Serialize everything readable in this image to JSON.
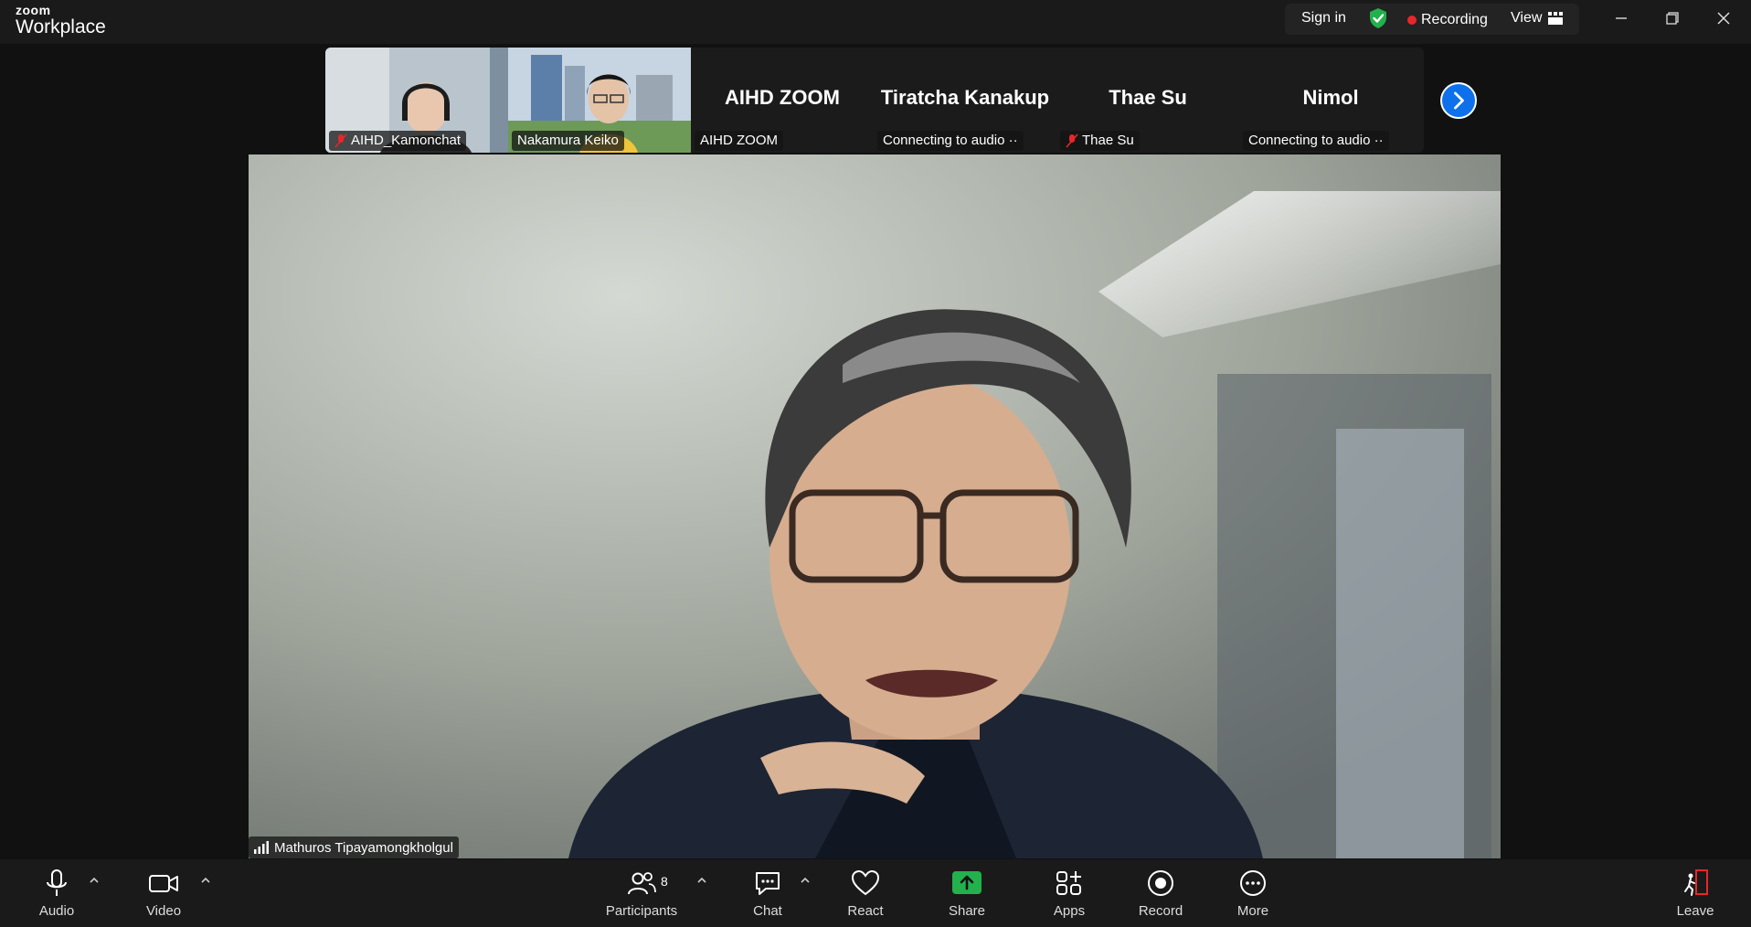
{
  "app": {
    "brand_top": "zoom",
    "brand_bottom": "Workplace"
  },
  "topbar": {
    "sign_in": "Sign in",
    "recording": "Recording",
    "view": "View",
    "icons": [
      "shield-check-icon",
      "grid-icon",
      "minimize-icon",
      "restore-icon",
      "close-icon"
    ],
    "colors": {
      "shield": "#22b14c",
      "record_dot": "#e8262b"
    }
  },
  "thumbnails": [
    {
      "caption": "AIHD_Kamonchat",
      "muted": true,
      "video": true
    },
    {
      "caption": "Nakamura Keiko",
      "muted": false,
      "video": true
    },
    {
      "title": "AIHD ZOOM",
      "caption": "AIHD ZOOM",
      "muted": false,
      "video": false
    },
    {
      "title": "Tiratcha Kanakup",
      "caption": "Connecting to audio ··",
      "muted": false,
      "video": false
    },
    {
      "title": "Thae Su",
      "caption": "Thae Su",
      "muted": true,
      "video": false
    },
    {
      "title": "Nimol",
      "caption": "Connecting to audio ··",
      "muted": false,
      "video": false
    }
  ],
  "main": {
    "speaker": "Mathuros Tipayamongkholgul"
  },
  "toolbar": {
    "audio": "Audio",
    "video": "Video",
    "participants": "Participants",
    "participants_count": "8",
    "chat": "Chat",
    "react": "React",
    "share": "Share",
    "apps": "Apps",
    "record": "Record",
    "more": "More",
    "leave": "Leave",
    "colors": {
      "share": "#22b14c",
      "leave": "#e8262b",
      "accent": "#0e71eb"
    }
  }
}
